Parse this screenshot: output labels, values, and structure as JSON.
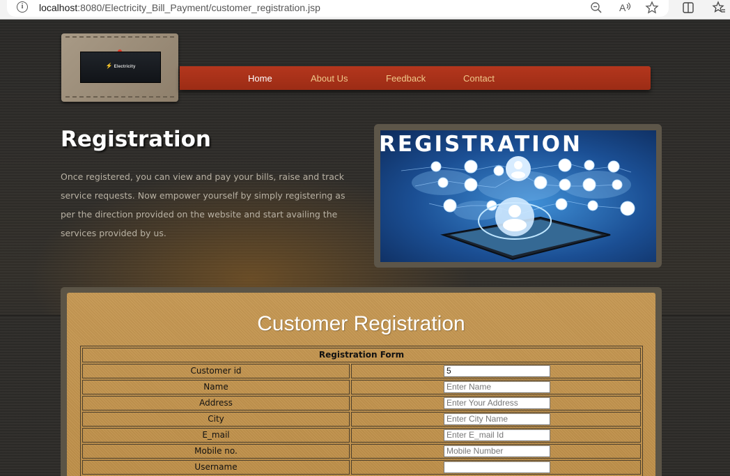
{
  "browser": {
    "url_host": "localhost",
    "url_rest": ":8080/Electricity_Bill_Payment/customer_registration.jsp"
  },
  "logo": {
    "text": "Electricity"
  },
  "nav": {
    "items": [
      {
        "label": "Home",
        "active": true
      },
      {
        "label": "About Us",
        "active": false
      },
      {
        "label": "Feedback",
        "active": false
      },
      {
        "label": "Contact",
        "active": false
      }
    ]
  },
  "hero": {
    "title": "Registration",
    "description": "Once registered, you can view and pay your bills, raise and track service requests. Now empower yourself by simply registering as per the direction provided on the website and start availing the services provided by us.",
    "image_text": "REGISTRATION"
  },
  "form": {
    "title": "Customer Registration",
    "table_header": "Registration Form",
    "fields": [
      {
        "label": "Customer id",
        "value": "5",
        "placeholder": ""
      },
      {
        "label": "Name",
        "value": "",
        "placeholder": "Enter Name"
      },
      {
        "label": "Address",
        "value": "",
        "placeholder": "Enter Your Address"
      },
      {
        "label": "City",
        "value": "",
        "placeholder": "Enter City Name"
      },
      {
        "label": "E_mail",
        "value": "",
        "placeholder": "Enter E_mail Id"
      },
      {
        "label": "Mobile no.",
        "value": "",
        "placeholder": "Mobile Number"
      },
      {
        "label": "Username",
        "value": "",
        "placeholder": ""
      }
    ]
  },
  "colors": {
    "nav_red": "#b4361d",
    "nav_text": "#f0c98a",
    "form_panel": "#c89a55"
  }
}
